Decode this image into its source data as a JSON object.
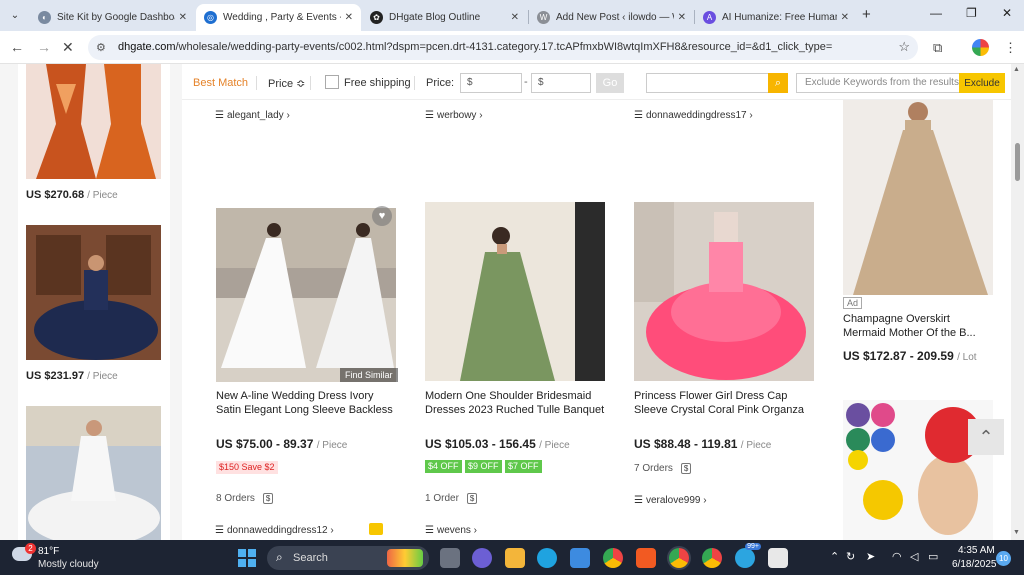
{
  "tabs": [
    {
      "title": "Site Kit by Google Dashboard",
      "active": false,
      "icon": "sitekit-icon"
    },
    {
      "title": "Wedding , Party & Events - D",
      "active": true,
      "icon": "dhgate-icon"
    },
    {
      "title": "DHgate Blog Outline",
      "active": false,
      "icon": "chatgpt-icon"
    },
    {
      "title": "Add New Post ‹ ilowdo — W",
      "active": false,
      "icon": "wordpress-icon"
    },
    {
      "title": "AI Humanize: Free Humaniz",
      "active": false,
      "icon": "ai-humanize-icon"
    }
  ],
  "address": {
    "domain": "dhgate.com",
    "path": "/wholesale/wedding-party-events/c002.html?dspm=pcen.drt-4131.category.17.tcAPfmxbWI8wtqImXFH8&resource_id=&d1_click_type="
  },
  "filter": {
    "best_match": "Best Match",
    "price_sort": "Price",
    "sort_icon": "≎",
    "free_shipping": "Free shipping",
    "price_label": "Price:",
    "min_placeholder": "$",
    "max_placeholder": "$",
    "dash": "-",
    "go": "Go",
    "exclude_placeholder": "Exclude Keywords from the results",
    "exclude_button": "Exclude"
  },
  "left_column": [
    {
      "price": "US $270.68",
      "unit": "/ Piece"
    },
    {
      "price": "US $231.97",
      "unit": "/ Piece"
    }
  ],
  "top_stores": [
    "alegant_lady",
    "werbowy",
    "donnaweddingdress17"
  ],
  "products": [
    {
      "title_line1": "New A-line Wedding Dress Ivory",
      "title_line2": "Satin Elegant Long Sleeve Backless",
      "price": "US $75.00 - 89.37",
      "unit": "/ Piece",
      "tags": [
        "$150 Save $2"
      ],
      "orders": "8 Orders",
      "store": "donnaweddingdress12",
      "find_similar": "Find Similar"
    },
    {
      "title_line1": "Modern One Shoulder Bridesmaid",
      "title_line2": "Dresses 2023 Ruched Tulle Banquet",
      "price": "US $105.03 - 156.45",
      "unit": "/ Piece",
      "tags": [
        "$4 OFF",
        "$9 OFF",
        "$7 OFF"
      ],
      "orders": "1 Order",
      "store": "wevens"
    },
    {
      "title_line1": "Princess Flower Girl Dress Cap",
      "title_line2": "Sleeve Crystal Coral Pink Organza",
      "price": "US $88.48 - 119.81",
      "unit": "/ Piece",
      "tags": [],
      "orders": "7 Orders",
      "store": "veralove999"
    }
  ],
  "ad": {
    "badge": "Ad",
    "title_line1": "Champagne Overskirt",
    "title_line2": "Mermaid Mother Of the B...",
    "price": "US $172.87 - 209.59",
    "unit": "/ Lot"
  },
  "taskbar": {
    "weather_badge": "2",
    "temp": "81°F",
    "desc": "Mostly cloudy",
    "search": "Search",
    "time": "4:35 AM",
    "date": "6/18/2025",
    "notifications": "10",
    "telegram_badge": "99+"
  }
}
